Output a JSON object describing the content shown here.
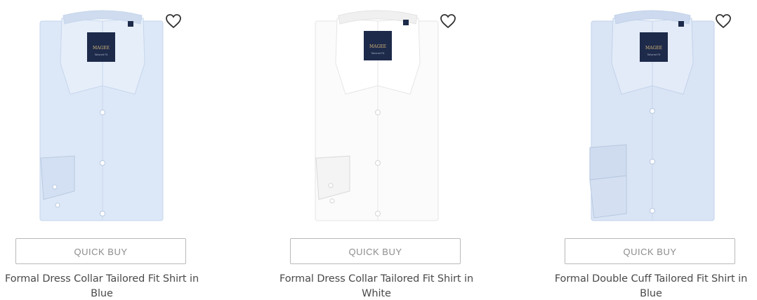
{
  "products": [
    {
      "shirt_color": "#dce8f7",
      "shirt_shade": "#c6d6ec",
      "label_brand": "MAGEE",
      "label_fit": "Tailored Fit",
      "quick_buy_label": "QUICK BUY",
      "title_line1": "Formal Dress Collar Tailored Fit Shirt in",
      "title_line2": "Blue",
      "wishlist_icon": "heart-outline-icon"
    },
    {
      "shirt_color": "#fbfbfb",
      "shirt_shade": "#e6e6e6",
      "label_brand": "MAGEE",
      "label_fit": "Tailored Fit",
      "quick_buy_label": "QUICK BUY",
      "title_line1": "Formal Dress Collar Tailored Fit Shirt in",
      "title_line2": "White",
      "wishlist_icon": "heart-outline-icon"
    },
    {
      "shirt_color": "#d9e4f5",
      "shirt_shade": "#c3d3ea",
      "label_brand": "MAGEE",
      "label_fit": "Tailored Fit",
      "quick_buy_label": "QUICK BUY",
      "title_line1": "Formal Double Cuff Tailored Fit Shirt in",
      "title_line2": "Blue",
      "wishlist_icon": "heart-outline-icon"
    }
  ]
}
